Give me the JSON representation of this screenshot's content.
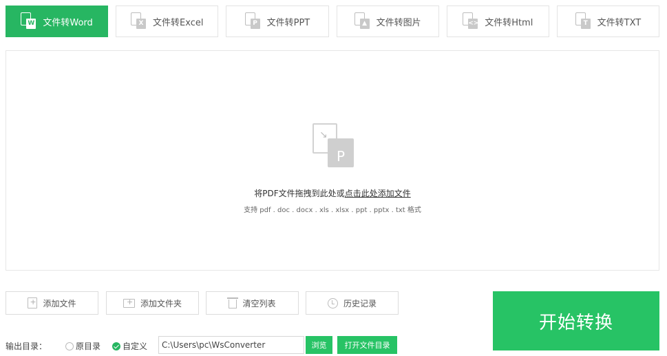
{
  "tabs": [
    {
      "label": "文件转Word",
      "badge": "W",
      "active": true
    },
    {
      "label": "文件转Excel",
      "badge": "X",
      "active": false
    },
    {
      "label": "文件转PPT",
      "badge": "P",
      "active": false
    },
    {
      "label": "文件转图片",
      "badge": "▲",
      "active": false
    },
    {
      "label": "文件转Html",
      "badge": "<>",
      "active": false
    },
    {
      "label": "文件转TXT",
      "badge": "T",
      "active": false
    }
  ],
  "dropzone": {
    "icon_letter": "P",
    "hint_prefix": "将PDF文件拖拽到此处或",
    "hint_link": "点击此处添加文件",
    "formats": "支持 pdf . doc . docx . xls . xlsx . ppt . pptx . txt 格式"
  },
  "actions": {
    "add_file": "添加文件",
    "add_folder": "添加文件夹",
    "clear_list": "清空列表",
    "history": "历史记录"
  },
  "start_label": "开始转换",
  "output": {
    "label": "输出目录：",
    "original_dir": "原目录",
    "custom": "自定义",
    "path": "C:\\Users\\pc\\WsConverter",
    "browse": "浏览",
    "open_dir": "打开文件目录"
  },
  "colors": {
    "accent": "#27b662",
    "start": "#27c365"
  }
}
